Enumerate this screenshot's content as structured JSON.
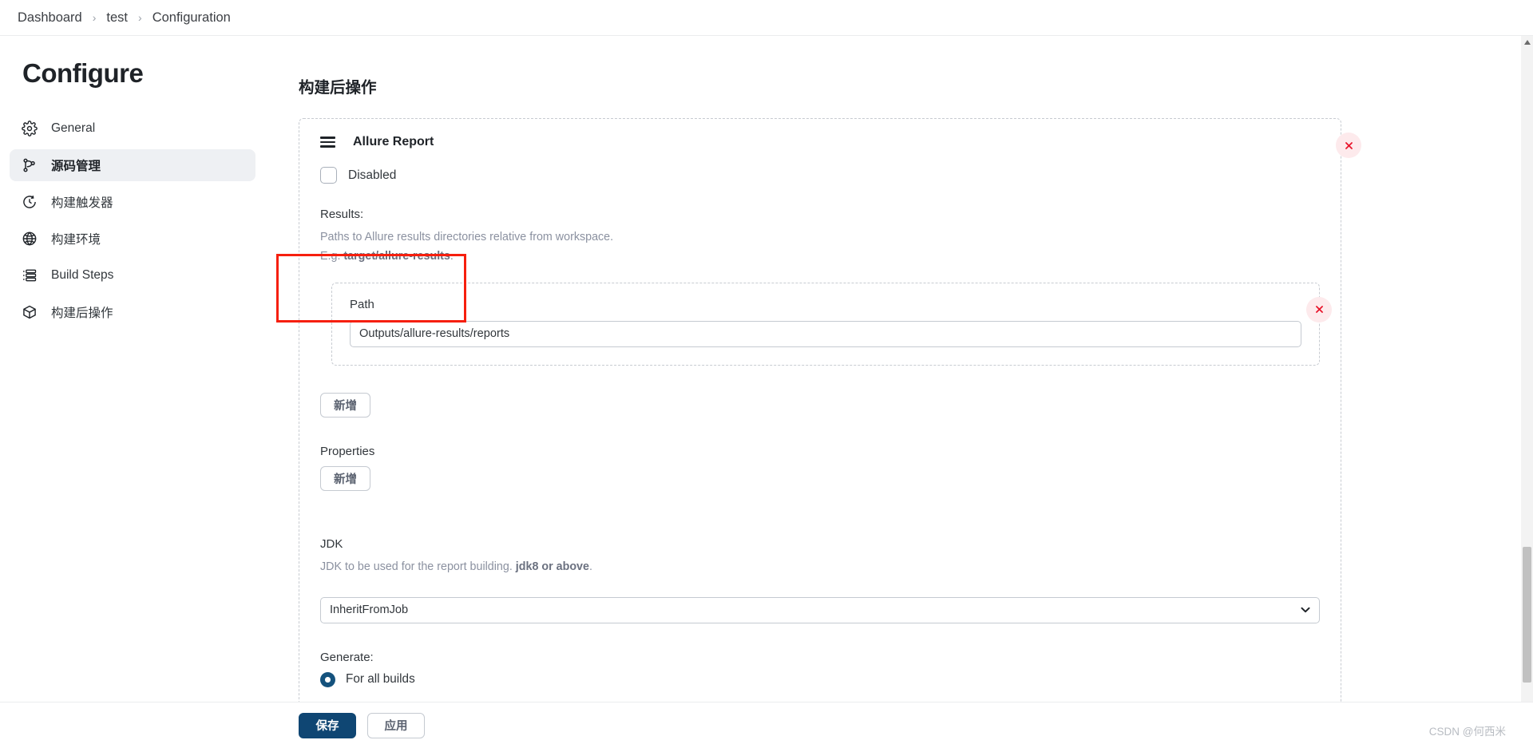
{
  "breadcrumb": {
    "items": [
      "Dashboard",
      "test",
      "Configuration"
    ],
    "separator": "›"
  },
  "sidebar": {
    "title": "Configure",
    "items": [
      {
        "label": "General",
        "icon": "gear-icon",
        "active": false
      },
      {
        "label": "源码管理",
        "icon": "branch-icon",
        "active": true
      },
      {
        "label": "构建触发器",
        "icon": "clock-icon",
        "active": false
      },
      {
        "label": "构建环境",
        "icon": "globe-icon",
        "active": false
      },
      {
        "label": "Build Steps",
        "icon": "list-icon",
        "active": false
      },
      {
        "label": "构建后操作",
        "icon": "package-icon",
        "active": false
      }
    ]
  },
  "main": {
    "section_title": "构建后操作",
    "block": {
      "title": "Allure Report",
      "drag_handle_icon": "drag-handle-icon",
      "delete_icon": "close-icon",
      "disabled_checkbox": {
        "label": "Disabled",
        "checked": false
      },
      "results": {
        "label": "Results:",
        "help_line1": "Paths to Allure results directories relative from workspace.",
        "help_line2_prefix": "E.g. ",
        "help_line2_strong": "target/allure-results",
        "help_line2_suffix": ".",
        "path_label": "Path",
        "path_value": "Outputs/allure-results/reports",
        "add_button": "新增"
      },
      "properties": {
        "label": "Properties",
        "add_button": "新增"
      },
      "jdk": {
        "label": "JDK",
        "help_prefix": "JDK to be used for the report building. ",
        "help_strong": "jdk8 or above",
        "help_suffix": ".",
        "selected": "InheritFromJob",
        "options": [
          "InheritFromJob"
        ],
        "chevron_icon": "chevron-down-icon"
      },
      "generate": {
        "label": "Generate:",
        "selected_option": "For all builds"
      }
    }
  },
  "footer": {
    "save_label": "保存",
    "apply_label": "应用"
  },
  "watermark": "CSDN @何西米",
  "scrollbar": {
    "up_arrow_icon": "chevron-up-icon",
    "down_arrow_icon": "chevron-down-icon"
  },
  "colors": {
    "accent": "#0f4673",
    "danger": "#e8152b",
    "annotation": "#f61f0e",
    "sidebar_active_bg": "#eef0f3"
  }
}
